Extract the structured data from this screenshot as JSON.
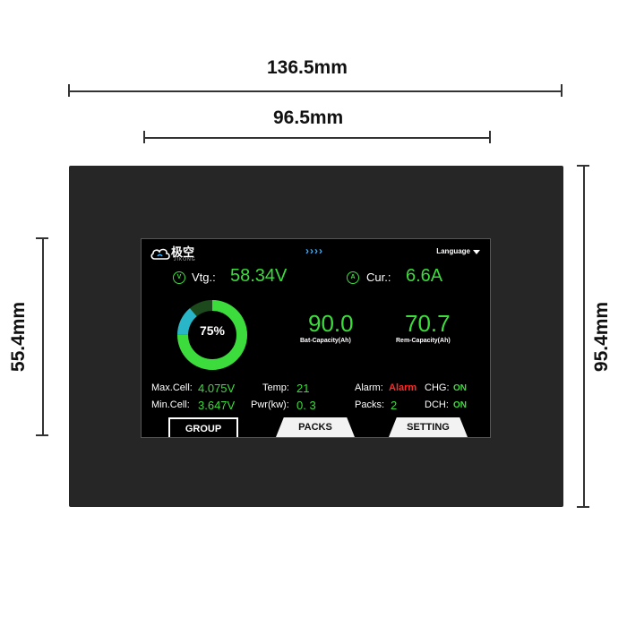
{
  "dimensions": {
    "outer_width": "136.5mm",
    "inner_width": "96.5mm",
    "screen_height": "55.4mm",
    "outer_height": "95.4mm"
  },
  "header": {
    "logo_text": "极空",
    "logo_sub": "JIKONG",
    "arrows": "››››",
    "language_label": "Language"
  },
  "metrics": {
    "voltage_icon": "V",
    "voltage_label": "Vtg.:",
    "voltage_value": "58.34V",
    "current_icon": "A",
    "current_label": "Cur.:",
    "current_value": "6.6A",
    "soc_percent": "75%",
    "soc_fraction": 0.75,
    "bat_capacity_value": "90.0",
    "bat_capacity_label": "Bat-Capacity(Ah)",
    "rem_capacity_value": "70.7",
    "rem_capacity_label": "Rem-Capacity(Ah)"
  },
  "stats": {
    "max_cell_label": "Max.Cell:",
    "max_cell_value": "4.075V",
    "min_cell_label": "Min.Cell:",
    "min_cell_value": "3.647V",
    "temp_label": "Temp:",
    "temp_value": "21",
    "pwr_label": "Pwr(kw):",
    "pwr_value": "0. 3",
    "alarm_label": "Alarm:",
    "alarm_value": "Alarm",
    "packs_label": "Packs:",
    "packs_value": "2",
    "chg_label": "CHG:",
    "chg_value": "ON",
    "dch_label": "DCH:",
    "dch_value": "ON"
  },
  "tabs": {
    "group": "GROUP",
    "packs": "PACKS",
    "setting": "SETTING"
  },
  "colors": {
    "accent_green": "#3cdc3c",
    "gauge_cyan": "#29b6c8",
    "alarm_red": "#ff2a2a",
    "arrow_blue": "#3ab0ff"
  }
}
